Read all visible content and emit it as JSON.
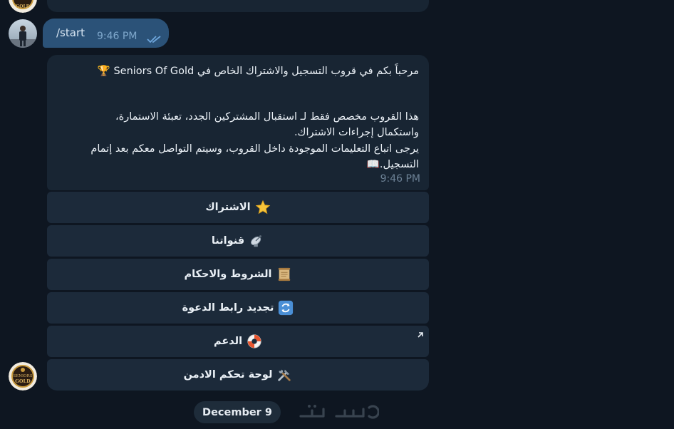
{
  "user_message": {
    "text": "/start",
    "time": "9:46 PM"
  },
  "bot_message": {
    "lines": [
      "مرحباً بكم في قروب التسجيل والاشتراك الخاص في Seniors Of Gold 🏆",
      "هذا القروب مخصص فقط لـ استقبال المشتركين الجدد، تعبئة الاستمارة،",
      "واستكمال إجراءات الاشتراك.",
      "يرجى اتباع التعليمات الموجودة داخل القروب، وسيتم التواصل معكم بعد إتمام",
      "التسجيل.📖"
    ],
    "time": "9:46 PM"
  },
  "keyboard": [
    {
      "label": "الاشتراك",
      "icon": "star-icon"
    },
    {
      "label": "قنواتنا",
      "icon": "satellite-dish-icon"
    },
    {
      "label": "الشروط والاحكام",
      "icon": "scroll-icon"
    },
    {
      "label": "تجديد رابط الدعوة",
      "icon": "refresh-icon"
    },
    {
      "label": "الدعم",
      "icon": "lifebuoy-icon"
    },
    {
      "label": "لوحة تحكم الادمن",
      "icon": "tools-icon"
    }
  ],
  "date_separator": "December 9",
  "watermark_text": "خمسات",
  "bot_avatar_text": [
    "SENIORS",
    "GOLD"
  ],
  "colors": {
    "background": "#0e1621",
    "incoming_bubble": "#182533",
    "outgoing_bubble": "#2b5278",
    "keyboard_button": "#1c2a3a",
    "time_text": "#6d8296"
  }
}
